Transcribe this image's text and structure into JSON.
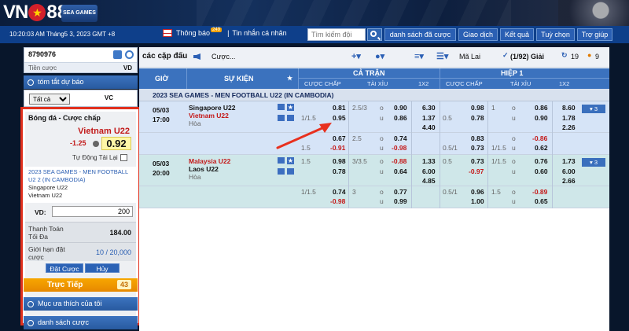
{
  "brand": {
    "logo_left": "VN",
    "logo_right": "88",
    "badge": "SEA GAMES 32"
  },
  "header": {
    "clock": "10:20:03 AM Tháng5 3, 2023 GMT +8",
    "notice": "Thông báo",
    "notice_badge": "249",
    "messages": "Tin nhắn cá nhân",
    "search_placeholder": "Tìm kiếm đội",
    "nav": [
      "danh sách đã cược",
      "Giao dịch",
      "Kết quả",
      "Tuỳ chọn",
      "Trợ giúp"
    ]
  },
  "account": {
    "id": "8790976",
    "label": "Tiền cược",
    "value": "VD"
  },
  "sidebar": {
    "summary_title": "tóm tắt dự báo",
    "filter_value": "Tất cả",
    "filter_right": "VC",
    "live_label": "Trực Tiếp",
    "live_count": "43",
    "fav_label": "Mục ưa thích của tôi",
    "list_label": "danh sách cược"
  },
  "slip": {
    "sport": "Bóng đá - Cược chấp",
    "team": "Vietnam U22",
    "handicap": "-1.25",
    "odds": "0.92",
    "auto_label": "Tự Động Tải Lại",
    "league": "2023 SEA GAMES - MEN FOOTBALL U2 2 (IN CAMBODIA)",
    "home": "Singapore U22",
    "away": "Vietnam U22",
    "stake_label": "VD:",
    "stake_value": "200",
    "max_label": "Thanh Toán Tối Đa",
    "max_value": "184.00",
    "limit_label": "Giới hạn đặt cược",
    "limit_value": "10 / 20,000",
    "place_btn": "Đặt Cược",
    "cancel_btn": "Hủy"
  },
  "toolbar": {
    "title": "các cặp đấu",
    "filter": "Cược...",
    "odds_type": "Mã Lai",
    "tournaments": "(1/92) Giải",
    "count_a": "19",
    "count_b": "9"
  },
  "table": {
    "col_time": "GIỜ",
    "col_event": "SỰ KIỆN",
    "full_match": "CẢ TRẬN",
    "first_half": "HIỆP 1",
    "sub_hdp": "CƯỢC CHẤP",
    "sub_ou": "TÀI XỈU",
    "sub_1x2": "1X2",
    "league": "2023 SEA GAMES - MEN FOOTBALL U22 (IN CAMBODIA)"
  },
  "matches": [
    {
      "date": "05/03",
      "time": "17:00",
      "home": "Singapore U22",
      "away": "Vietnam U22",
      "draw": "Hòa",
      "more": "▾ 3",
      "main": {
        "hdp_line": "1/1.5",
        "hdp_home": "0.81",
        "hdp_away": "0.95",
        "ou_line": "2.5/3",
        "ou_o": "o",
        "ou_u": "u",
        "ou_over": "0.90",
        "ou_under": "0.86",
        "x1": "6.30",
        "x2": "1.37",
        "xd": "4.40",
        "h1_hdp_line": "0.5",
        "h1_home": "0.98",
        "h1_away": "0.78",
        "h1_ou_line": "1",
        "h1_over": "0.86",
        "h1_under": "0.90",
        "h1_x1": "8.60",
        "h1_x2": "1.78",
        "h1_xd": "2.26"
      },
      "alt": {
        "hdp_line": "1.5",
        "hdp_home": "0.67",
        "hdp_away": "-0.91",
        "ou_line": "2.5",
        "ou_over": "0.74",
        "ou_under": "-0.98",
        "h1_hdp_line": "0.5/1",
        "h1_home": "0.83",
        "h1_away": "1/1.5",
        "h1_ou_line2": "1/1.5",
        "h1_over": "-0.86",
        "h1_under": "0.62",
        "h1_away_val": "0.73"
      }
    },
    {
      "date": "05/03",
      "time": "20:00",
      "home": "Malaysia U22",
      "away": "Laos U22",
      "draw": "Hòa",
      "more": "▾ 3",
      "main": {
        "hdp_line": "1.5",
        "hdp_home": "0.98",
        "hdp_away": "0.78",
        "ou_line": "3/3.5",
        "ou_over": "-0.88",
        "ou_under": "0.64",
        "x1": "1.33",
        "x2": "6.00",
        "xd": "4.85",
        "h1_hdp_line": "0.5",
        "h1_home": "0.73",
        "h1_away": "-0.97",
        "h1_ou_line": "1/1.5",
        "h1_over": "0.76",
        "h1_under": "0.60",
        "h1_x1": "1.73",
        "h1_x2": "6.00",
        "h1_xd": "2.66"
      },
      "alt": {
        "hdp_line": "1/1.5",
        "hdp_home": "0.74",
        "hdp_away": "-0.98",
        "ou_line": "3",
        "ou_over": "0.77",
        "ou_under": "0.99",
        "h1_hdp_line": "0.5/1",
        "h1_home": "0.96",
        "h1_away": "1.00",
        "h1_ou_line": "1.5",
        "h1_over": "-0.89",
        "h1_under": "0.65"
      }
    }
  ]
}
